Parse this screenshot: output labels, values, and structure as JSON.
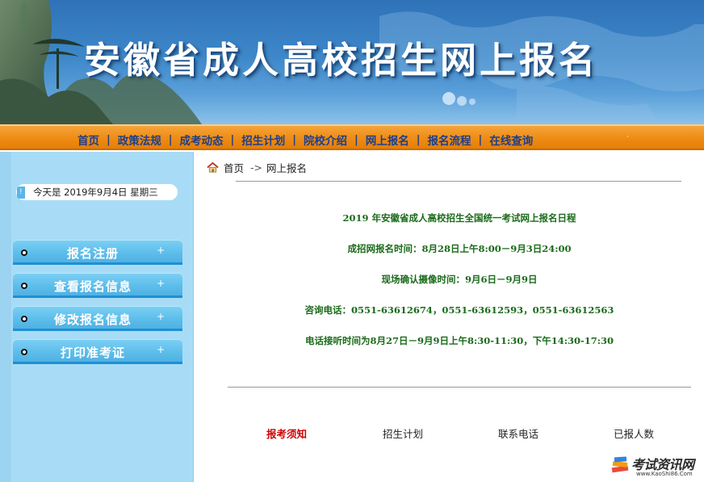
{
  "banner": {
    "title": "安徽省成人高校招生网上报名"
  },
  "nav": {
    "items": [
      "首页",
      "政策法规",
      "成考动态",
      "招生计划",
      "院校介绍",
      "网上报名",
      "报名流程",
      "在线查询"
    ],
    "separator": "|",
    "trailing_mark": "·"
  },
  "sidebar": {
    "date_text": "今天是  2019年9月4日  星期三",
    "menu": [
      {
        "label": "报名注册",
        "icon": "bullet-icon",
        "expand": "+"
      },
      {
        "label": "查看报名信息",
        "icon": "bullet-icon",
        "expand": "+"
      },
      {
        "label": "修改报名信息",
        "icon": "bullet-icon",
        "expand": "+"
      },
      {
        "label": "打印准考证",
        "icon": "bullet-icon",
        "expand": "+"
      }
    ]
  },
  "breadcrumb": {
    "home": "首页",
    "arrow": "->",
    "current": "网上报名"
  },
  "notice": {
    "title": "2019 年安徽省成人高校招生全国统一考试网上报名日程",
    "lines": [
      "成招网报名时间：8月28日上午8:00－9月3日24:00",
      "现场确认摄像时间：9月6日－9月9日",
      "咨询电话：0551-63612674，0551-63612593，0551-63612563",
      "电话接听时间为8月27日－9月9日上午8:30-11:30，下午14:30-17:30"
    ]
  },
  "bottom_links": [
    "报考须知",
    "招生计划",
    "联系电话",
    "已报人数"
  ],
  "logo": {
    "text": "考试资讯网",
    "sub": "www.KaoShi86.Com"
  },
  "colors": {
    "nav_bg": "#ee8c14",
    "nav_text": "#1c3f8c",
    "sidebar_bg": "#a8dcf6",
    "menu_button": "#5cbdea",
    "notice_text": "#1a6b1a",
    "highlight_link": "#d00000"
  }
}
